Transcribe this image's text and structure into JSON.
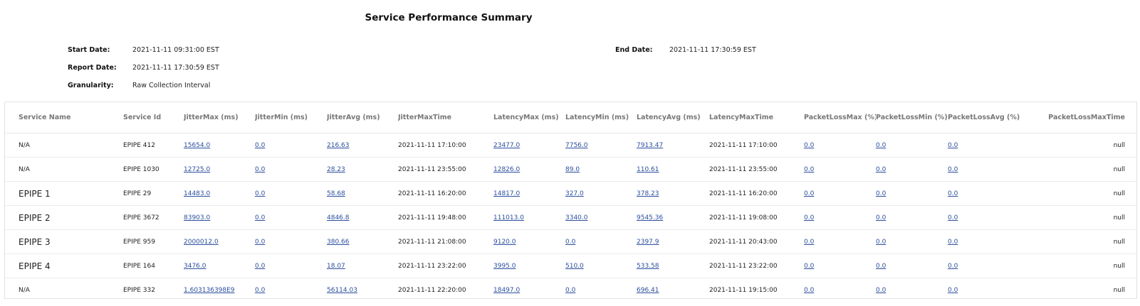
{
  "title": "Service Performance Summary",
  "meta": {
    "start_date_label": "Start Date:",
    "start_date_value": "2021-11-11 09:31:00 EST",
    "end_date_label": "End Date:",
    "end_date_value": "2021-11-11 17:30:59 EST",
    "report_date_label": "Report Date:",
    "report_date_value": "2021-11-11 17:30:59 EST",
    "granularity_label": "Granularity:",
    "granularity_value": "Raw Collection Interval"
  },
  "table": {
    "headers": [
      "Service Name",
      "Service Id",
      "JitterMax (ms)",
      "JitterMin (ms)",
      "JitterAvg (ms)",
      "JitterMaxTime",
      "LatencyMax (ms)",
      "LatencyMin (ms)",
      "LatencyAvg (ms)",
      "LatencyMaxTime",
      "PacketLossMax (%)",
      "PacketLossMin (%)",
      "PacketLossAvg (%)",
      "PacketLossMaxTime"
    ],
    "rows": [
      [
        "N/A",
        "EPIPE 412",
        "15654.0",
        "0.0",
        "216.63",
        "2021-11-11 17:10:00",
        "23477.0",
        "7756.0",
        "7913.47",
        "2021-11-11 17:10:00",
        "0.0",
        "0.0",
        "0.0",
        "null"
      ],
      [
        "N/A",
        "EPIPE 1030",
        "12725.0",
        "0.0",
        "28.23",
        "2021-11-11 23:55:00",
        "12826.0",
        "89.0",
        "110.61",
        "2021-11-11 23:55:00",
        "0.0",
        "0.0",
        "0.0",
        "null"
      ],
      [
        "EPIPE 1",
        "EPIPE 29",
        "14483.0",
        "0.0",
        "58.68",
        "2021-11-11 16:20:00",
        "14817.0",
        "327.0",
        "378.23",
        "2021-11-11 16:20:00",
        "0.0",
        "0.0",
        "0.0",
        "null"
      ],
      [
        "EPIPE 2",
        "EPIPE 3672",
        "83903.0",
        "0.0",
        "4846.8",
        "2021-11-11 19:48:00",
        "111013.0",
        "3340.0",
        "9545.36",
        "2021-11-11 19:08:00",
        "0.0",
        "0.0",
        "0.0",
        "null"
      ],
      [
        "EPIPE 3",
        "EPIPE 959",
        "2000012.0",
        "0.0",
        "380.66",
        "2021-11-11 21:08:00",
        "9120.0",
        "0.0",
        "2397.9",
        "2021-11-11 20:43:00",
        "0.0",
        "0.0",
        "0.0",
        "null"
      ],
      [
        "EPIPE 4",
        "EPIPE 164",
        "3476.0",
        "0.0",
        "18.07",
        "2021-11-11 23:22:00",
        "3995.0",
        "510.0",
        "533.58",
        "2021-11-11 23:22:00",
        "0.0",
        "0.0",
        "0.0",
        "null"
      ],
      [
        "N/A",
        "EPIPE 332",
        "1.603136398E9",
        "0.0",
        "56114.03",
        "2021-11-11 22:20:00",
        "18497.0",
        "0.0",
        "696.41",
        "2021-11-11 19:15:00",
        "0.0",
        "0.0",
        "0.0",
        "null"
      ]
    ]
  },
  "colors": {
    "link": "#2c4f9e",
    "header_text": "#777777",
    "border": "#e1e1e1"
  }
}
